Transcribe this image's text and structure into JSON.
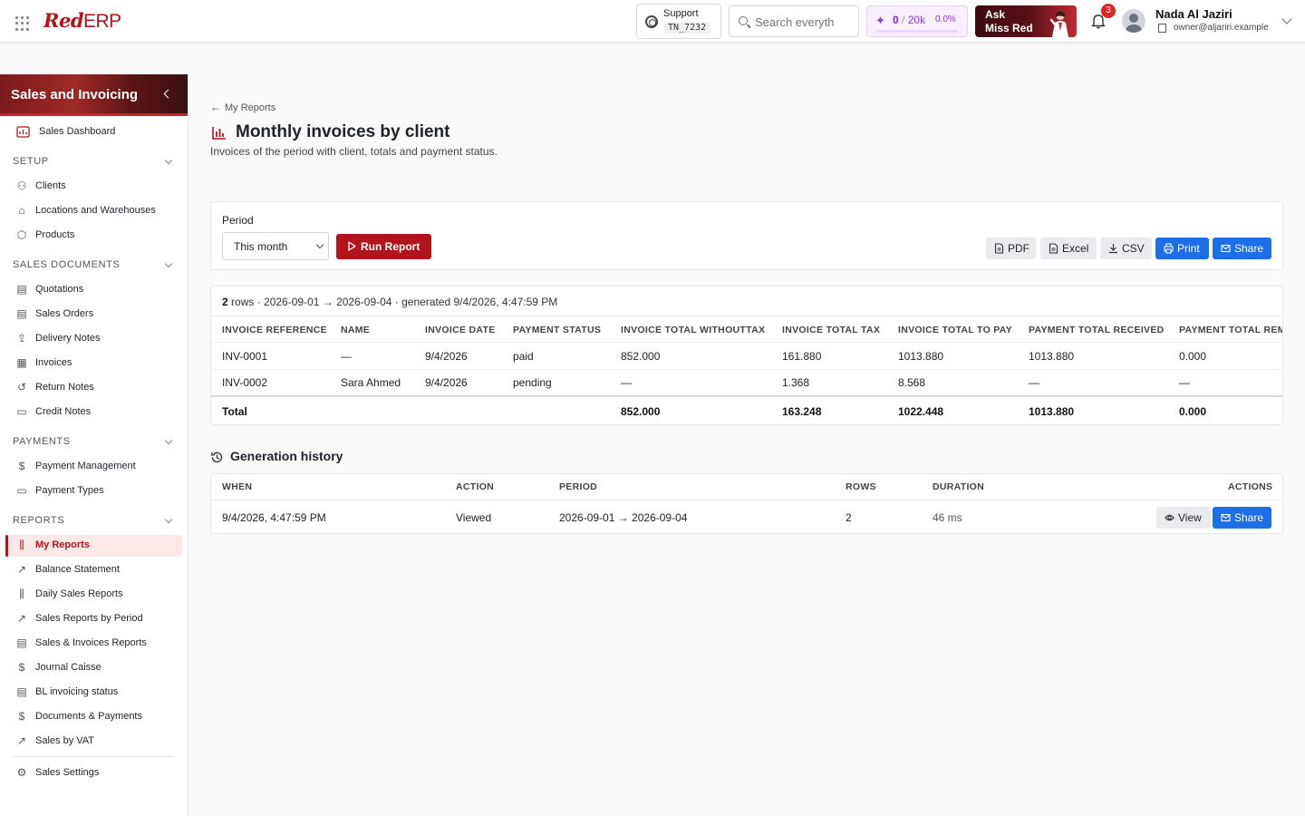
{
  "topbar": {
    "logo_red": "Red",
    "logo_erp": "ERP",
    "support_label": "Support",
    "support_code": "TN_7232",
    "search_placeholder": "Search everyth",
    "credits_used": "0",
    "credits_sep": "/",
    "credits_total": "20k",
    "credits_pct": "0.0%",
    "credits_fraction": 0.0,
    "ask_line1": "Ask",
    "ask_line2": "Miss Red",
    "notif_count": "3",
    "user_name": "Nada Al Jaziri",
    "user_email": "owner@aljariri.example"
  },
  "sidebar": {
    "title": "Sales and Invoicing",
    "dashboard": "Sales Dashboard",
    "sections": {
      "setup": "SETUP",
      "sales_documents": "SALES DOCUMENTS",
      "payments": "PAYMENTS",
      "reports": "REPORTS"
    },
    "setup_items": [
      "Clients",
      "Locations and Warehouses",
      "Products"
    ],
    "sales_doc_items": [
      "Quotations",
      "Sales Orders",
      "Delivery Notes",
      "Invoices",
      "Return Notes",
      "Credit Notes"
    ],
    "payment_items": [
      "Payment Management",
      "Payment Types"
    ],
    "report_items": [
      "My Reports",
      "Balance Statement",
      "Daily Sales Reports",
      "Sales Reports by Period",
      "Sales & Invoices Reports",
      "Journal Caisse",
      "BL invoicing status",
      "Documents & Payments",
      "Sales by VAT"
    ],
    "settings": "Sales Settings"
  },
  "main": {
    "back_label": "My Reports",
    "title": "Monthly invoices by client",
    "subtitle": "Invoices of the period with client, totals and payment status.",
    "period_label": "Period",
    "period_value": "This month",
    "run_label": "Run Report",
    "export_buttons": [
      "PDF",
      "Excel",
      "CSV",
      "Print",
      "Share"
    ]
  },
  "table": {
    "row_count": "2",
    "meta_rest": "rows · 2026-09-01 → 2026-09-04 · generated 9/4/2026, 4:47:59 PM",
    "columns": [
      "INVOICE REFERENCE",
      "NAME",
      "INVOICE DATE",
      "PAYMENT STATUS",
      "INVOICE TOTAL WITHOUTTAX",
      "INVOICE TOTAL TAX",
      "INVOICE TOTAL TO PAY",
      "PAYMENT TOTAL RECEIVED",
      "PAYMENT TOTAL REMA"
    ],
    "rows": [
      [
        "INV-0001",
        "—",
        "9/4/2026",
        "paid",
        "852.000",
        "161.880",
        "1013.880",
        "1013.880",
        "0.000"
      ],
      [
        "INV-0002",
        "Sara Ahmed",
        "9/4/2026",
        "pending",
        "—",
        "1.368",
        "8.568",
        "—",
        "—"
      ]
    ],
    "total_label": "Total",
    "totals": [
      "852.000",
      "163.248",
      "1022.448",
      "1013.880",
      "0.000"
    ]
  },
  "history": {
    "title": "Generation history",
    "columns": [
      "WHEN",
      "ACTION",
      "PERIOD",
      "ROWS",
      "DURATION",
      "ACTIONS"
    ],
    "row": {
      "when": "9/4/2026, 4:47:59 PM",
      "action": "Viewed",
      "period": "2026-09-01 → 2026-09-04",
      "rows": "2",
      "duration": "46 ms"
    },
    "view_label": "View",
    "share_label": "Share"
  },
  "colors": {
    "brand": "#b1151b",
    "primary": "#1d6fe8",
    "credits": "#9333ea"
  }
}
